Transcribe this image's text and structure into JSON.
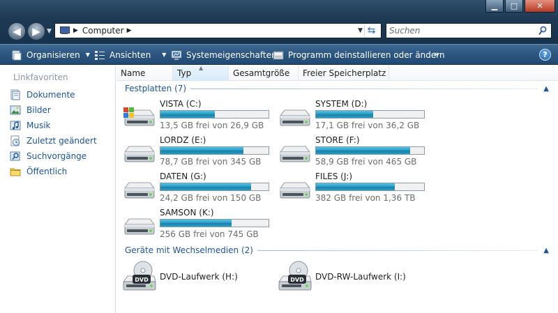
{
  "window": {
    "minimize": "▁",
    "maximize": "□",
    "close": "✕"
  },
  "nav": {
    "back": "◀",
    "forward": "▶"
  },
  "address": {
    "crumbs": [
      "Computer"
    ]
  },
  "search": {
    "placeholder": "Suchen"
  },
  "toolbar": {
    "organize": "Organisieren",
    "views": "Ansichten",
    "system_properties": "Systemeigenschaften",
    "uninstall": "Programm deinstallieren oder ändern",
    "more": "»",
    "help": "?"
  },
  "sidebar": {
    "title": "Linkfavoriten",
    "items": [
      {
        "label": "Dokumente",
        "icon": "documents-icon"
      },
      {
        "label": "Bilder",
        "icon": "pictures-icon"
      },
      {
        "label": "Musik",
        "icon": "music-icon"
      },
      {
        "label": "Zuletzt geändert",
        "icon": "recent-icon"
      },
      {
        "label": "Suchvorgänge",
        "icon": "searches-icon"
      },
      {
        "label": "Öffentlich",
        "icon": "public-folder-icon"
      }
    ]
  },
  "columns": [
    "Name",
    "Typ",
    "Gesamtgröße",
    "Freier Speicherplatz"
  ],
  "groups": {
    "hdd": "Festplatten (7)",
    "removable": "Geräte mit Wechselmedien (2)"
  },
  "drives": [
    {
      "name": "VISTA (C:)",
      "free": "13,5 GB frei von 26,9 GB",
      "used": 0.5,
      "system": true
    },
    {
      "name": "SYSTEM (D:)",
      "free": "17,1 GB frei von 36,2 GB",
      "used": 0.53
    },
    {
      "name": "LORDZ (E:)",
      "free": "78,7 GB frei von 345 GB",
      "used": 0.77
    },
    {
      "name": "STORE (F:)",
      "free": "58,9 GB frei von 465 GB",
      "used": 0.87
    },
    {
      "name": "DATEN (G:)",
      "free": "24,2 GB frei von 150 GB",
      "used": 0.84
    },
    {
      "name": "FILES (J:)",
      "free": "382 GB frei von 1,36 TB",
      "used": 0.73
    },
    {
      "name": "SAMSON (K:)",
      "free": "256 GB frei von 745 GB",
      "used": 0.66
    }
  ],
  "removable": [
    {
      "name": "DVD-Laufwerk (H:)",
      "badge": "DVD"
    },
    {
      "name": "DVD-RW-Laufwerk (I:)",
      "badge": "DVD"
    }
  ],
  "colors": {
    "accent": "#1d55a2",
    "bar": "#2b9dc7"
  }
}
